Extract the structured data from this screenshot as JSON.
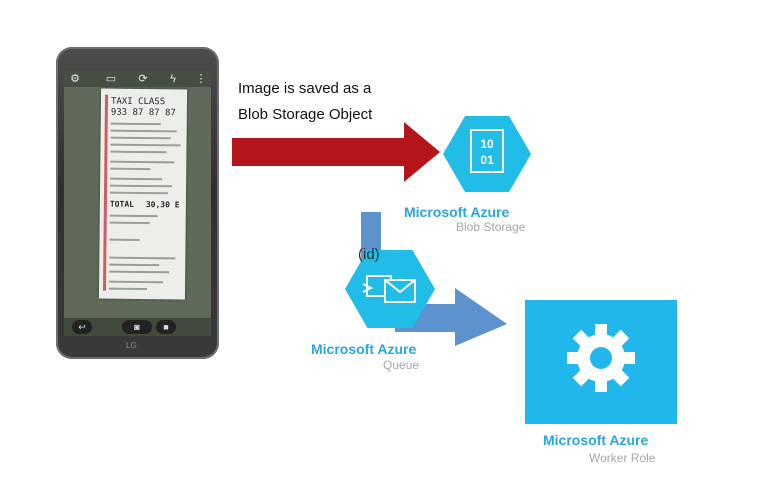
{
  "caption": {
    "line1": "Image is saved as a",
    "line2": "Blob Storage Object"
  },
  "phone": {
    "brand": "LG",
    "receipt_lines": [
      "TAXI CLASS",
      "933 87 87 87",
      "TOTAL",
      "30,30 E"
    ]
  },
  "blob_storage": {
    "icon_text_line1": "10",
    "icon_text_line2": "01",
    "title": "Microsoft Azure",
    "subtitle": "Blob Storage"
  },
  "queue": {
    "id_label": "(id)",
    "title": "Microsoft Azure",
    "subtitle": "Queue"
  },
  "worker_role": {
    "title": "Microsoft Azure",
    "subtitle": "Worker Role"
  },
  "colors": {
    "azure": "#21b7ea",
    "arrow_red": "#b3151b",
    "arrow_blue": "#4a86c8",
    "title_blue": "#2aa6dc"
  }
}
